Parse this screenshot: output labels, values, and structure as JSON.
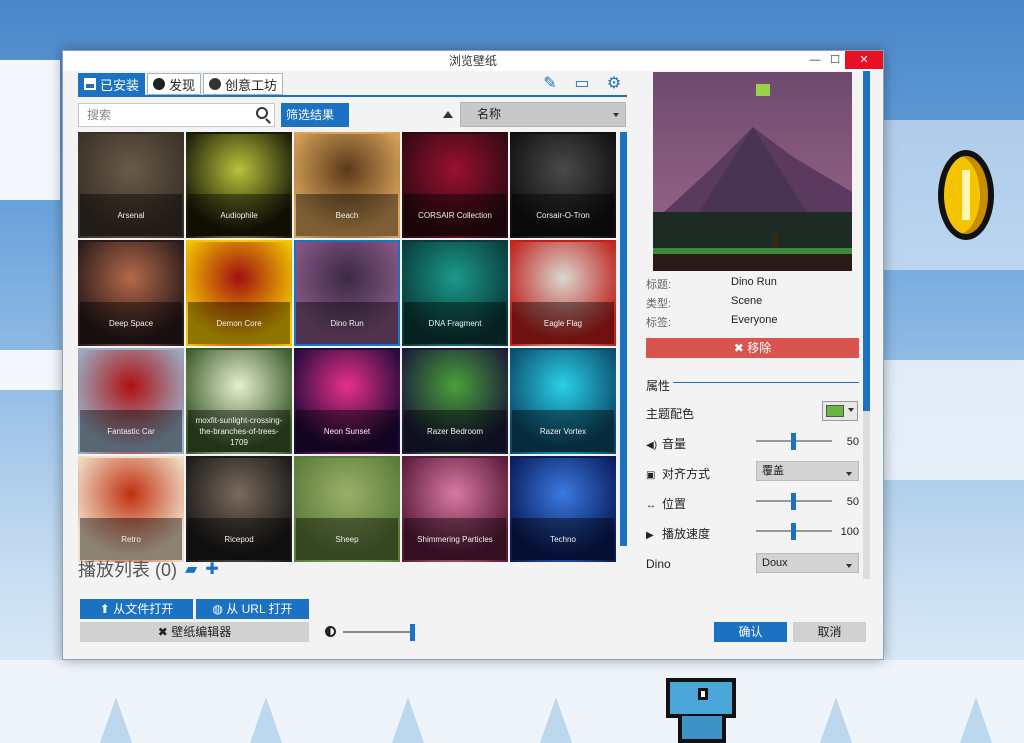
{
  "window": {
    "title": "浏览壁纸",
    "min_glyph": "—",
    "max_glyph": "☐",
    "close_glyph": "✕"
  },
  "tabs": [
    {
      "label": "已安装",
      "active": true
    },
    {
      "label": "发现",
      "active": false
    },
    {
      "label": "创意工坊",
      "active": false
    }
  ],
  "toolbar_icons": [
    "magic-wand-icon",
    "monitor-icon",
    "gear-icon"
  ],
  "search": {
    "placeholder": "搜索"
  },
  "filter": {
    "label": "筛选结果"
  },
  "sort": {
    "value": "名称"
  },
  "wallpapers": [
    {
      "name": "Arsenal",
      "colors": [
        "#3a3128",
        "#6a5a48"
      ]
    },
    {
      "name": "Audiophile",
      "colors": [
        "#1a1a08",
        "#b8c23a"
      ]
    },
    {
      "name": "Beach",
      "colors": [
        "#d9a35a",
        "#5a3a1a"
      ]
    },
    {
      "name": "CORSAIR Collection",
      "colors": [
        "#300a12",
        "#9a1030"
      ]
    },
    {
      "name": "Corsair-O-Tron",
      "colors": [
        "#101010",
        "#4a4a4a"
      ]
    },
    {
      "name": "Deep Space",
      "colors": [
        "#2a1a1a",
        "#b36a4a"
      ]
    },
    {
      "name": "Demon Core",
      "colors": [
        "#f5c800",
        "#a01010"
      ]
    },
    {
      "name": "Dino Run",
      "colors": [
        "#8a5a88",
        "#3a2a44"
      ]
    },
    {
      "name": "DNA Fragment",
      "colors": [
        "#0a3a3a",
        "#1a9a8a"
      ]
    },
    {
      "name": "Eagle Flag",
      "colors": [
        "#c0201a",
        "#d8d8d0"
      ]
    },
    {
      "name": "Fantastic Car",
      "colors": [
        "#9ab0c8",
        "#b01010"
      ]
    },
    {
      "name": "moxfit-sunlight-crossing-the-branches-of-trees-1709",
      "colors": [
        "#3a5a2a",
        "#e8f0d0"
      ]
    },
    {
      "name": "Neon Sunset",
      "colors": [
        "#200a3a",
        "#e8308a"
      ]
    },
    {
      "name": "Razer Bedroom",
      "colors": [
        "#1a1a3a",
        "#4aa03a"
      ]
    },
    {
      "name": "Razer Vortex",
      "colors": [
        "#0a4a6a",
        "#2ad0e8"
      ]
    },
    {
      "name": "Retro",
      "colors": [
        "#f0e0c8",
        "#c03010"
      ]
    },
    {
      "name": "Ricepod",
      "colors": [
        "#1a1a1a",
        "#7a6a5a"
      ]
    },
    {
      "name": "Sheep",
      "colors": [
        "#5a7a3a",
        "#9ab068"
      ]
    },
    {
      "name": "Shimmering Particles",
      "colors": [
        "#5a1a3a",
        "#d87aa0"
      ]
    },
    {
      "name": "Techno",
      "colors": [
        "#0a1a5a",
        "#3a7ae0"
      ]
    }
  ],
  "playlist": {
    "label": "播放列表 (0)"
  },
  "buttons": {
    "open_file": "从文件打开",
    "open_url": "从 URL 打开",
    "editor": "壁纸编辑器",
    "ok": "确认",
    "cancel": "取消",
    "remove": "移除"
  },
  "details": {
    "title_label": "标题:",
    "title_value": "Dino Run",
    "type_label": "类型:",
    "type_value": "Scene",
    "tag_label": "标签:",
    "tag_value": "Everyone"
  },
  "properties": {
    "section": "属性",
    "theme_color_label": "主题配色",
    "theme_color": "#6db33f",
    "volume_label": "音量",
    "volume_value": "50",
    "align_label": "对齐方式",
    "align_value": "覆盖",
    "position_label": "位置",
    "position_value": "50",
    "speed_label": "播放速度",
    "speed_value": "100",
    "dino_label": "Dino",
    "dino_value": "Doux"
  },
  "accent": "#1b72c2"
}
